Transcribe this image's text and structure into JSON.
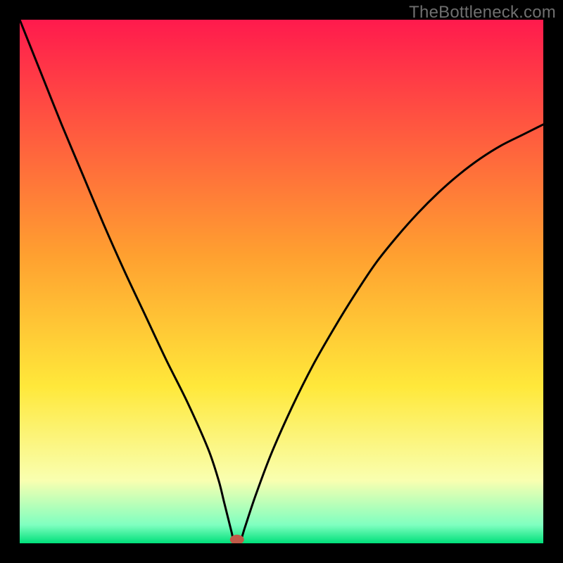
{
  "watermark": "TheBottleneck.com",
  "chart_data": {
    "type": "line",
    "title": "",
    "xlabel": "",
    "ylabel": "",
    "xlim": [
      0,
      100
    ],
    "ylim": [
      0,
      100
    ],
    "grid": false,
    "background_gradient_stops": [
      {
        "offset": 0.0,
        "color": "#ff1a4d"
      },
      {
        "offset": 0.45,
        "color": "#ffa030"
      },
      {
        "offset": 0.7,
        "color": "#ffe83a"
      },
      {
        "offset": 0.88,
        "color": "#f9ffb0"
      },
      {
        "offset": 0.965,
        "color": "#7fffc0"
      },
      {
        "offset": 1.0,
        "color": "#00e07a"
      }
    ],
    "series": [
      {
        "name": "bottleneck-curve",
        "x": [
          0,
          4,
          8,
          12,
          16,
          20,
          24,
          28,
          32,
          36,
          38,
          39,
          40,
          40.5,
          41,
          42,
          43,
          45,
          48,
          52,
          56,
          60,
          64,
          68,
          72,
          76,
          80,
          84,
          88,
          92,
          96,
          100
        ],
        "values": [
          100,
          90,
          80,
          70.5,
          61,
          52,
          43.5,
          35,
          27,
          18,
          12,
          8,
          4,
          2,
          0,
          0,
          3,
          9,
          17,
          26,
          34,
          41,
          47.5,
          53.5,
          58.5,
          63,
          67,
          70.5,
          73.5,
          76,
          78,
          80
        ]
      }
    ],
    "marker": {
      "x": 41.5,
      "y": 0.7,
      "color": "#c05a48",
      "rx": 10,
      "ry": 7
    },
    "curve_stroke": "#000000",
    "curve_width": 3
  }
}
